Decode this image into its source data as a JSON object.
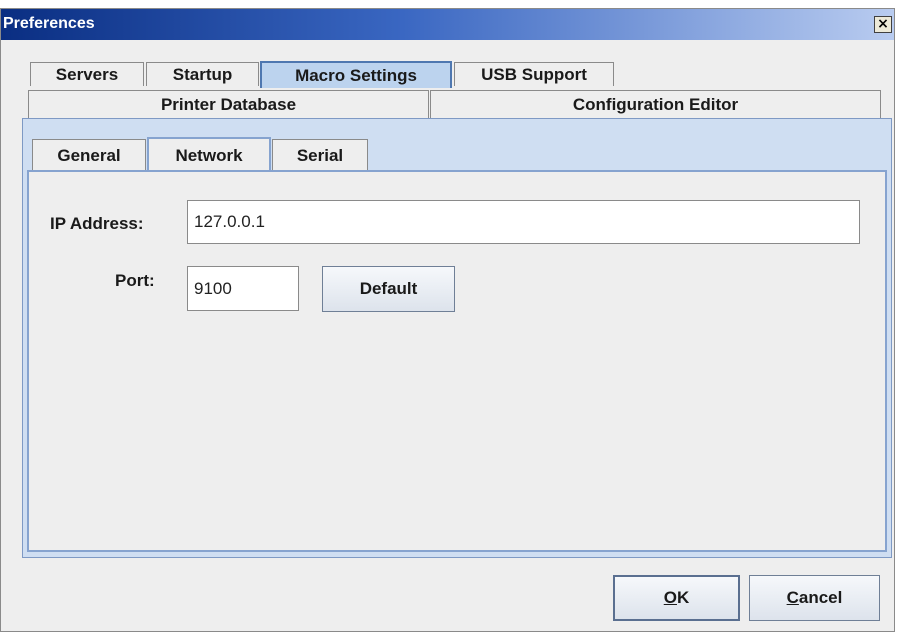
{
  "window": {
    "title": "Preferences",
    "close_glyph": "×"
  },
  "main_tabs": {
    "row1": [
      {
        "label": "Servers",
        "selected": false
      },
      {
        "label": "Startup",
        "selected": false
      },
      {
        "label": "Macro Settings",
        "selected": true
      },
      {
        "label": "USB Support",
        "selected": false
      }
    ],
    "row2": [
      {
        "label": "Printer Database",
        "selected": false
      },
      {
        "label": "Configuration Editor",
        "selected": false
      }
    ]
  },
  "sub_tabs": [
    {
      "label": "General",
      "selected": false
    },
    {
      "label": "Network",
      "selected": true
    },
    {
      "label": "Serial",
      "selected": false
    }
  ],
  "network": {
    "ip_label": "IP Address:",
    "ip_value": "127.0.0.1",
    "port_label": "Port:",
    "port_value": "9100",
    "default_label": "Default"
  },
  "footer": {
    "ok_mnemonic": "O",
    "ok_rest": "K",
    "cancel_mnemonic": "C",
    "cancel_rest": "ancel"
  },
  "colors": {
    "selected_tab": "#bcd3ee",
    "title_start": "#0a2e82",
    "title_end": "#b9ccf0"
  }
}
